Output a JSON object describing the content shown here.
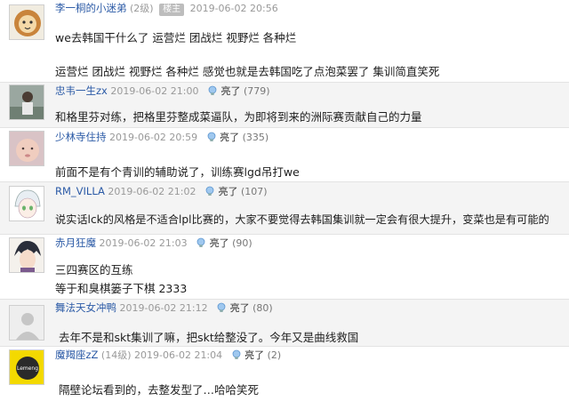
{
  "post1": {
    "username": "李一桐的小迷弟",
    "level": "(2级)",
    "badge": "楼主",
    "time": "2019-06-02 20:56",
    "line1": "we去韩国干什么了 运营烂 团战烂 视野烂 各种烂",
    "line2": "运营烂 团战烂 视野烂 各种烂 感觉也就是去韩国吃了点泡菜罢了 集训简直笑死"
  },
  "like_label": "亮了",
  "post2": {
    "username": "忠韦一生zx",
    "time": "2019-06-02 21:00",
    "likes": "(779)",
    "text": "和格里芬对练，把格里芬整成菜逼队，为即将到来的洲际赛贡献自己的力量"
  },
  "post3": {
    "username": "少林寺住持",
    "time": "2019-06-02 20:59",
    "likes": "(335)",
    "text": "前面不是有个青训的辅助说了，训练赛lgd吊打we"
  },
  "post4": {
    "username": "RM_VILLA",
    "time": "2019-06-02 21:02",
    "likes": "(107)",
    "text": "说实话lck的风格是不适合lpl比赛的，大家不要觉得去韩国集训就一定会有很大提升，变菜也是有可能的"
  },
  "post5": {
    "username": "赤月狂魔",
    "time": "2019-06-02 21:03",
    "likes": "(90)",
    "line1": "三四赛区的互练",
    "line2": "等于和臭棋篓子下棋 2333"
  },
  "post6": {
    "username": "舞法天女冲鸭",
    "time": "2019-06-02 21:12",
    "likes": "(80)",
    "text": "去年不是和skt集训了嘛，把skt给整没了。今年又是曲线救国"
  },
  "post7": {
    "username": "魔羯座zZ",
    "level": "(14级)",
    "time": "2019-06-02 21:04",
    "likes": "(2)",
    "text": "隔壁论坛看到的，去整发型了…哈哈笑死",
    "avatar_text": "Lemeng"
  },
  "colors": {
    "username": "#2b5aa6",
    "meta": "#999999",
    "badge": "#bdbdbd"
  }
}
